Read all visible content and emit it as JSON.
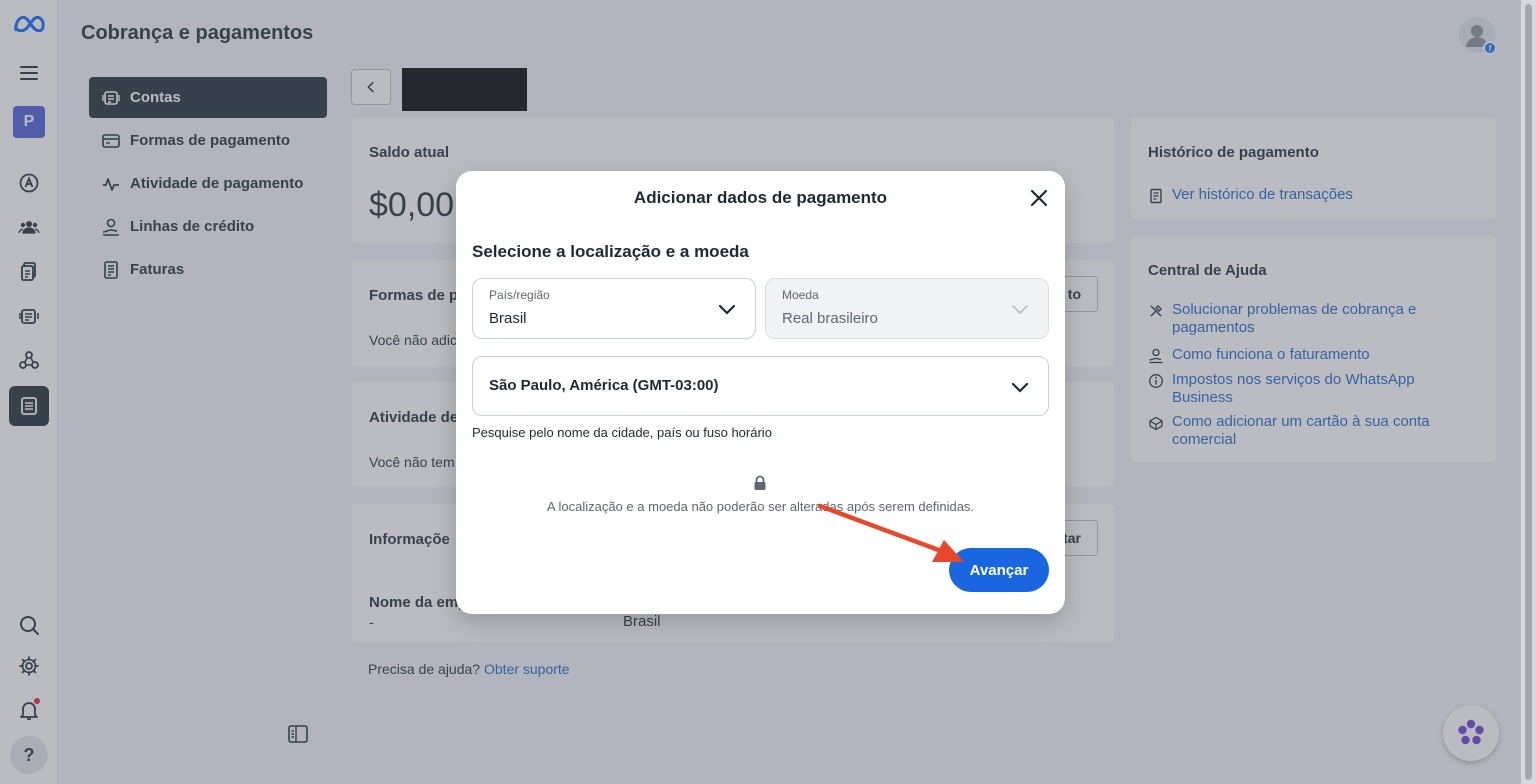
{
  "header": {
    "title": "Cobrança e pagamentos"
  },
  "rail": {
    "workspace_initial": "P",
    "help_symbol": "?"
  },
  "subnav": [
    {
      "label": "Contas",
      "icon": "accounts-icon",
      "active": true
    },
    {
      "label": "Formas de pagamento",
      "icon": "card-icon"
    },
    {
      "label": "Atividade de pagamento",
      "icon": "activity-icon"
    },
    {
      "label": "Linhas de crédito",
      "icon": "credit-icon"
    },
    {
      "label": "Faturas",
      "icon": "invoice-icon"
    }
  ],
  "main": {
    "balance": {
      "title": "Saldo atual",
      "amount": "$0,00"
    },
    "methods": {
      "title": "Formas de p",
      "text": "Você não adic",
      "button_fragment": "to"
    },
    "activity": {
      "title": "Atividade de",
      "text": "Você não tem"
    },
    "info": {
      "title": "Informaçõe",
      "button_fragment": "tar",
      "company_label": "Nome da emp",
      "company_value": "-",
      "country_value": "Brasil"
    },
    "help_line": {
      "text": "Precisa de ajuda?",
      "link": "Obter suporte"
    }
  },
  "side": {
    "history": {
      "title": "Histórico de pagamento",
      "link": "Ver histórico de transações"
    },
    "help_center": {
      "title": "Central de Ajuda",
      "links": [
        {
          "line1": "Solucionar problemas de cobrança e",
          "line2": "pagamentos",
          "icon": "tools-icon"
        },
        {
          "line1": "Como funciona o faturamento",
          "line2": "",
          "icon": "hand-coin-icon"
        },
        {
          "line1": "Impostos nos serviços do WhatsApp",
          "line2": "Business",
          "icon": "info-icon"
        },
        {
          "line1": "Como adicionar um cartão à sua conta",
          "line2": "comercial",
          "icon": "wallet-icon"
        }
      ]
    }
  },
  "modal": {
    "title": "Adicionar dados de pagamento",
    "subtitle": "Selecione a localização e a moeda",
    "country": {
      "label": "País/região",
      "value": "Brasil"
    },
    "currency": {
      "label": "Moeda",
      "value": "Real brasileiro"
    },
    "timezone": {
      "value": "São Paulo, América (GMT-03:00)",
      "hint": "Pesquise pelo nome da cidade, país ou fuso horário"
    },
    "lock_note": "A localização e a moeda não poderão ser alteradas após serem definidas.",
    "primary_button": "Avançar"
  },
  "colors": {
    "primary": "#1a66e0",
    "link": "#1a66c9",
    "dark": "#1c2b33",
    "arrow": "#e8472a"
  }
}
